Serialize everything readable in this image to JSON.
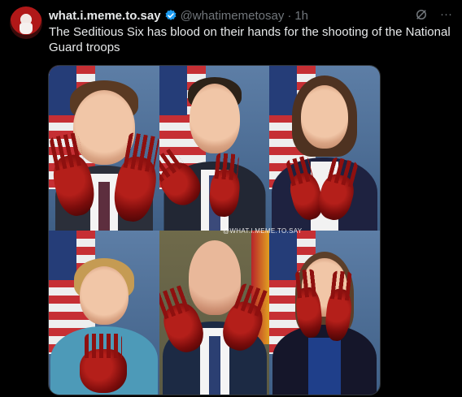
{
  "post": {
    "author_name": "what.i.meme.to.say",
    "author_handle": "@whatimemetosay",
    "separator": "·",
    "time": "1h",
    "text": "The Seditious Six has blood on their hands for the shooting of the National Guard troops",
    "more_label": "···",
    "grok_icon": "grok-icon"
  },
  "media": {
    "watermark": "@WHAT.I.MEME.TO.SAY"
  },
  "colors": {
    "background": "#000000",
    "text": "#e7e9ea",
    "muted": "#71767b",
    "verified": "#1d9bf0"
  }
}
